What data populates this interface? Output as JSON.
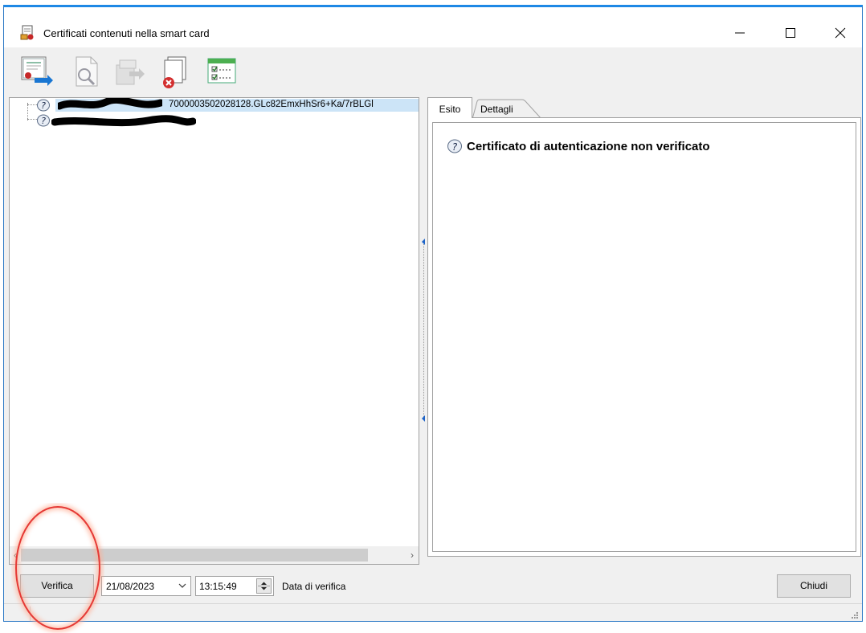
{
  "window": {
    "title": "Certificati contenuti nella smart card"
  },
  "toolbar": {
    "buttons": [
      {
        "icon": "certificate-export-icon"
      },
      {
        "icon": "magnifier-document-icon"
      },
      {
        "icon": "package-export-icon"
      },
      {
        "icon": "document-delete-icon"
      },
      {
        "icon": "checklist-icon"
      }
    ]
  },
  "tree": {
    "items": [
      {
        "icon": "question-mark-icon",
        "label_visible_tail": "7000003502028128.GLc82EmxHhSr6+Ka/7rBLGl",
        "selected": true
      },
      {
        "icon": "question-mark-icon",
        "label_visible_tail": "",
        "selected": false
      }
    ]
  },
  "tabs": {
    "esito": "Esito",
    "dettagli": "Dettagli",
    "active": "Esito"
  },
  "result": {
    "icon": "question-mark-icon",
    "text": "Certificato di autenticazione non verificato"
  },
  "footer": {
    "verify_label": "Verifica",
    "date_value": "21/08/2023",
    "time_value": "13:15:49",
    "date_label": "Data di verifica",
    "close_label": "Chiudi"
  },
  "colors": {
    "accent": "#1e88e5",
    "selection": "#cce4f7",
    "annotation": "#e53935"
  }
}
